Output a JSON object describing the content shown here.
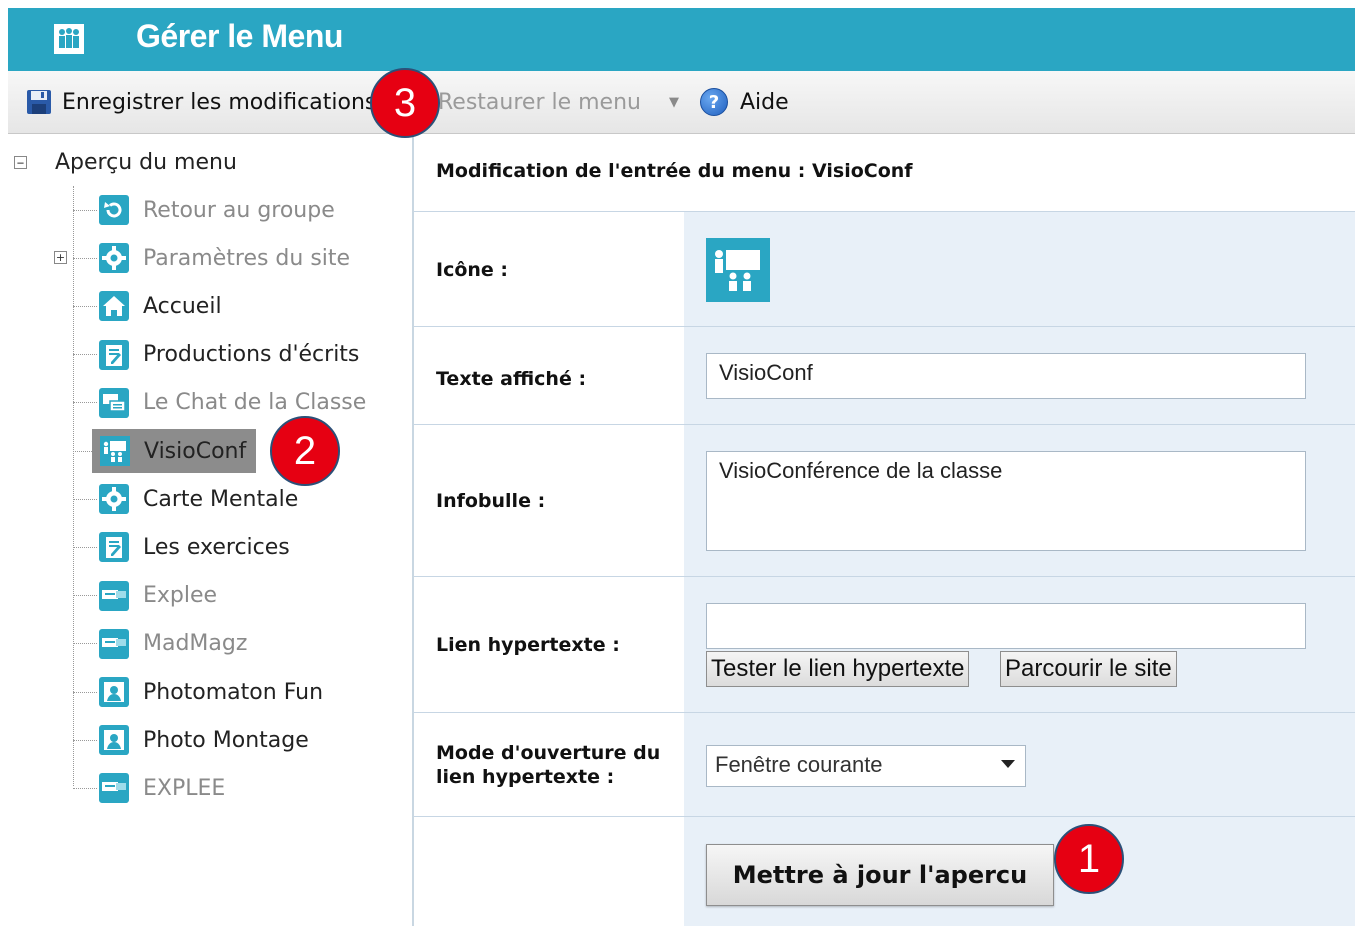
{
  "header": {
    "title": "Gérer le Menu"
  },
  "toolbar": {
    "save_label": "Enregistrer les modifications",
    "restore_label": "Restaurer le menu",
    "help_label": "Aide",
    "help_glyph": "?"
  },
  "callouts": {
    "one": "1",
    "two": "2",
    "three": "3"
  },
  "tree": {
    "root_label": "Aperçu du menu",
    "root_toggle": "−",
    "expander": "+",
    "items": [
      {
        "label": "Retour au groupe",
        "icon": "return-icon",
        "state": "dim"
      },
      {
        "label": "Paramètres du site",
        "icon": "gear-icon",
        "state": "dim"
      },
      {
        "label": "Accueil",
        "icon": "home-icon",
        "state": "normal"
      },
      {
        "label": "Productions d'écrits",
        "icon": "clipboard-icon",
        "state": "normal"
      },
      {
        "label": "Le Chat de la Classe",
        "icon": "chat-icon",
        "state": "dim"
      },
      {
        "label": "VisioConf",
        "icon": "conference-icon",
        "state": "selected"
      },
      {
        "label": "Carte Mentale",
        "icon": "gear-icon",
        "state": "normal"
      },
      {
        "label": "Les exercices",
        "icon": "clipboard-icon",
        "state": "normal"
      },
      {
        "label": "Explee",
        "icon": "link-icon",
        "state": "dim"
      },
      {
        "label": "MadMagz",
        "icon": "link-icon",
        "state": "dim"
      },
      {
        "label": "Photomaton Fun",
        "icon": "photo-icon",
        "state": "normal"
      },
      {
        "label": "Photo Montage",
        "icon": "photo-icon",
        "state": "normal"
      },
      {
        "label": "EXPLEE",
        "icon": "link-icon",
        "state": "dim"
      }
    ]
  },
  "form": {
    "title": "Modification de l'entrée du menu : VisioConf",
    "icon_label": "Icône :",
    "text_label": "Texte affiché :",
    "text_value": "VisioConf",
    "tooltip_label": "Infobulle :",
    "tooltip_value": "VisioConférence de la classe",
    "link_label": "Lien hypertexte :",
    "link_value": "",
    "test_link_button": "Tester le lien hypertexte",
    "browse_button": "Parcourir le site",
    "mode_label_line1": "Mode d'ouverture du",
    "mode_label_line2": "lien hypertexte :",
    "mode_value": "Fenêtre courante",
    "update_button": "Mettre à jour l'apercu"
  },
  "colors": {
    "header": "#2aa6c3",
    "accent_icon": "#2aa6c3",
    "callout": "#e60012",
    "form_bg": "#e8f0f8"
  }
}
